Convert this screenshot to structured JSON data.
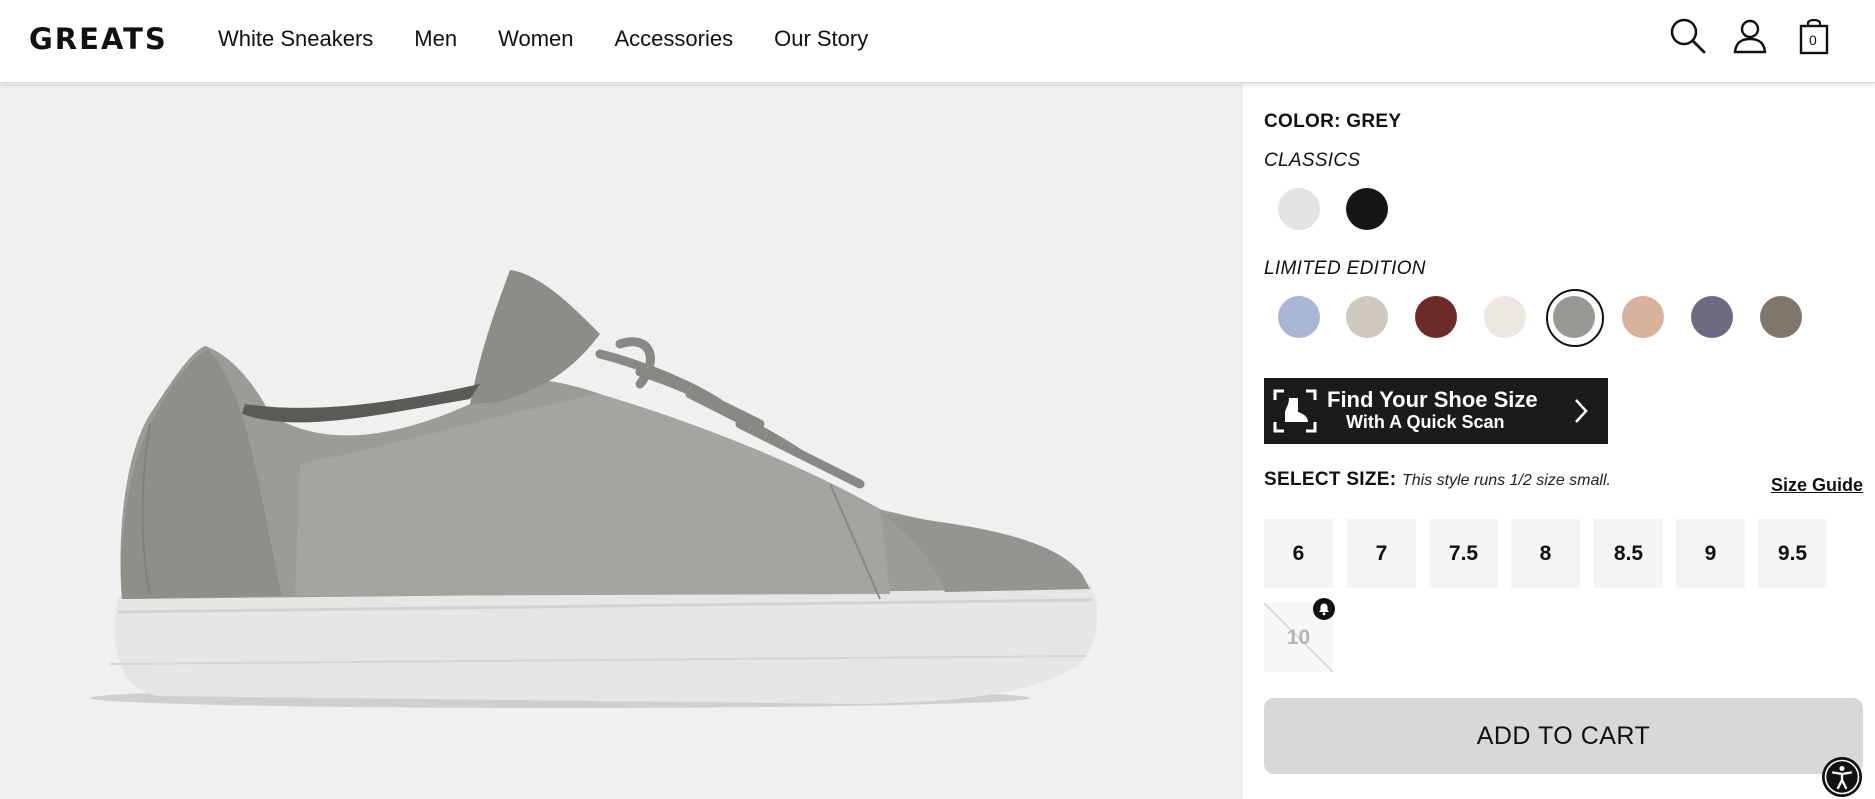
{
  "brand": {
    "logo": "GREATS"
  },
  "nav": {
    "items": [
      "White Sneakers",
      "Men",
      "Women",
      "Accessories",
      "Our Story"
    ]
  },
  "header_icons": {
    "search": "search-icon",
    "account": "user-icon",
    "cart": "shopping-bag-icon",
    "cart_count": "0"
  },
  "product": {
    "color_label": "COLOR: GREY",
    "classics_label": "CLASSICS",
    "limited_label": "LIMITED EDITION",
    "classics_swatches": [
      {
        "name": "white",
        "color": "#e4e4e4"
      },
      {
        "name": "black",
        "color": "#161616"
      }
    ],
    "limited_swatches": [
      {
        "name": "blue-white",
        "color": "#a9b6d6"
      },
      {
        "name": "snake",
        "color": "#cfc9bf"
      },
      {
        "name": "burgundy",
        "color": "#6d2b27"
      },
      {
        "name": "cream",
        "color": "#ebe8e1"
      },
      {
        "name": "grey",
        "color": "#9a9893",
        "selected": true
      },
      {
        "name": "blush",
        "color": "#d9b29c"
      },
      {
        "name": "slate",
        "color": "#6c6b82"
      },
      {
        "name": "camo",
        "color": "#7f776c"
      }
    ]
  },
  "scan_button": {
    "line1": "Find Your Shoe Size",
    "line2": "With A Quick Scan"
  },
  "sizes": {
    "label": "SELECT SIZE:",
    "note": "This style runs 1/2 size small.",
    "guide": "Size Guide",
    "options": [
      "6",
      "7",
      "7.5",
      "8",
      "8.5",
      "9",
      "9.5",
      "10"
    ],
    "sold_out": [
      "10"
    ]
  },
  "add_to_cart": "ADD TO CART",
  "colors": {
    "accent": "#111111",
    "panel_bg": "#f0f0f0",
    "button_bg": "#d8d8da"
  }
}
